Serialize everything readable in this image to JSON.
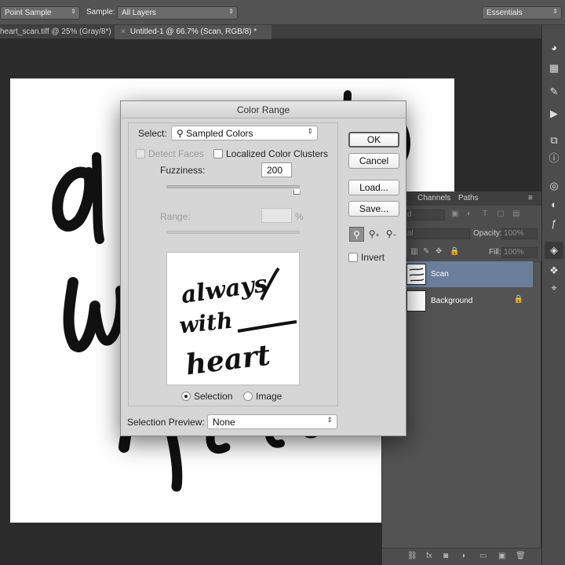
{
  "options_bar": {
    "sample_size": "Point Sample",
    "sample_label": "Sample:",
    "sample_value": "All Layers",
    "workspace": "Essentials"
  },
  "doc_tabs": [
    {
      "label": "heart_scan.tiff @ 25% (Gray/8*)"
    },
    {
      "label": "Untitled-1 @ 66.7% (Scan, RGB/8) *"
    }
  ],
  "canvas": {
    "lettering": "always with heart"
  },
  "layers_panel": {
    "tabs": [
      "Channels",
      "Paths"
    ],
    "filter_kind": "d",
    "blend_mode": "al",
    "opacity_label": "Opacity:",
    "opacity_value": "100%",
    "fill_label": "Fill:",
    "fill_value": "100%",
    "layers": [
      {
        "name": "Scan",
        "selected": true
      },
      {
        "name": "Background",
        "selected": false,
        "locked": true
      }
    ]
  },
  "dialog": {
    "title": "Color Range",
    "select_label": "Select:",
    "select_value": "Sampled Colors",
    "detect_faces": "Detect Faces",
    "localized": "Localized Color Clusters",
    "fuzziness_label": "Fuzziness:",
    "fuzziness_value": "200",
    "fuzziness_level": 0.98,
    "range_label": "Range:",
    "range_unit": "%",
    "preview_text": "always with heart",
    "radio_selection": "Selection",
    "radio_image": "Image",
    "preview_label": "Selection Preview:",
    "preview_value": "None",
    "buttons": {
      "ok": "OK",
      "cancel": "Cancel",
      "load": "Load...",
      "save": "Save..."
    },
    "invert_label": "Invert"
  }
}
